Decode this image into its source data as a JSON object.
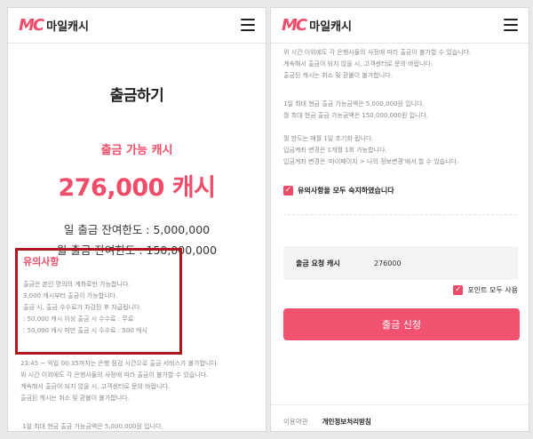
{
  "brand": {
    "mark": "MC",
    "name": "마일캐시"
  },
  "left": {
    "page_title": "출금하기",
    "available_label": "출금 가능 캐시",
    "available_amount": "276,000 캐시",
    "daily_limit": "일 출금 잔여한도 : 5,000,000",
    "monthly_limit": "월 출금 잔여한도 : 150,000,000",
    "notice_title": "유의사항",
    "notice_lines": [
      "출금은 본인 명의의 계좌로만 가능합니다.",
      "3,000 캐시부터 출금이 가능합니다.",
      "출금 시, 출금 수수료가 차감된 후 지급됩니다.",
      " : 50,000 캐시 이상 출금 시 수수료 : 무료",
      " : 50,000 캐시 미만 출금 시 수수료 : 500 캐시"
    ],
    "below_lines": [
      "23:45 ~ 익일 00:35까지는 은행 점검 시간으로 출금 서비스가 불가합니다.",
      "위 시간 이외에도 각 은행사들의 사정에 따라 출금이 불가할 수 있습니다.",
      "계속해서 출금이 되지 않을 시, 고객센터로 문의 바랍니다.",
      "출금된 캐시는 취소 및 환불이 불가합니다."
    ],
    "below_final": "1일 최대 현금 출금 가능금액은 5,000,000원 입니다."
  },
  "right": {
    "block_a": [
      "위 시간 이외에도 각 은행사들의 사정에 따라 출금이 불가할 수 있습니다.",
      "계속해서 출금이 되지 않을 시, 고객센터로 문의 바랍니다.",
      "출금된 캐시는 취소 및 환불이 불가합니다."
    ],
    "block_b": [
      "1일 최대 현금 출금 가능금액은 5,000,000원 입니다.",
      "월 최대 현금 출금 가능금액은 150,000,000원 입니다."
    ],
    "block_c": [
      "월 한도는 매월 1일 초기화 됩니다.",
      "입금계좌 변경은 1개월 1회 가능합니다.",
      "입금계좌 변경은 '마이페이지 > 나의 정보변경'에서 할 수 있습니다."
    ],
    "agree_label": "유의사항을 모두 숙지하였습니다",
    "request_label": "출금 요청 캐시",
    "request_value": "276000",
    "point_label": "포인트 모두 사용",
    "submit_label": "출금 신청",
    "footer_terms": "이용약관",
    "footer_privacy": "개인정보처리방침"
  },
  "colors": {
    "accent": "#ef4c6a",
    "highlight_border": "#b0161b"
  },
  "icons": {
    "menu": "hamburger-icon",
    "check": "checkbox-checked-icon"
  }
}
